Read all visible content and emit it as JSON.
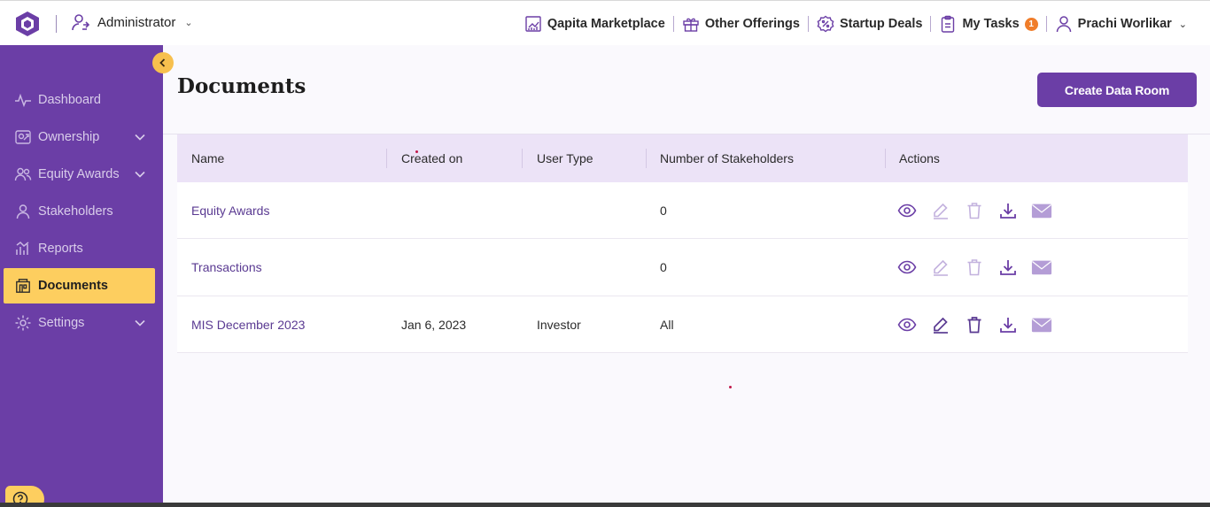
{
  "header": {
    "role_label": "Administrator",
    "nav": [
      {
        "label": "Qapita Marketplace",
        "icon": "chart-board-icon"
      },
      {
        "label": "Other Offerings",
        "icon": "gift-icon"
      },
      {
        "label": "Startup Deals",
        "icon": "percent-badge-icon"
      },
      {
        "label": "My Tasks",
        "icon": "clipboard-icon",
        "badge": "1"
      },
      {
        "label": "Prachi Worlikar",
        "icon": "user-icon"
      }
    ]
  },
  "sidebar": {
    "items": [
      {
        "label": "Dashboard",
        "icon": "activity-icon"
      },
      {
        "label": "Ownership",
        "icon": "ownership-icon"
      },
      {
        "label": "Equity Awards",
        "icon": "users-icon"
      },
      {
        "label": "Stakeholders",
        "icon": "user-icon"
      },
      {
        "label": "Reports",
        "icon": "bar-chart-icon"
      },
      {
        "label": "Documents",
        "icon": "building-icon",
        "active": true
      },
      {
        "label": "Settings",
        "icon": "gear-icon"
      }
    ]
  },
  "main": {
    "title": "Documents",
    "create_button": "Create Data Room",
    "columns": [
      "Name",
      "Created on",
      "User Type",
      "Number of Stakeholders",
      "Actions"
    ],
    "rows": [
      {
        "name": "Equity Awards",
        "created_on": "",
        "user_type": "",
        "stakeholders": "0",
        "editable": false
      },
      {
        "name": "Transactions",
        "created_on": "",
        "user_type": "",
        "stakeholders": "0",
        "editable": false
      },
      {
        "name": "MIS December 2023",
        "created_on": "Jan 6, 2023",
        "user_type": "Investor",
        "stakeholders": "All",
        "editable": true
      }
    ]
  },
  "colors": {
    "brand_purple": "#6b3ea6",
    "accent_yellow": "#fdce5f",
    "header_row": "#ece3f7",
    "badge_orange": "#f07d2a"
  }
}
